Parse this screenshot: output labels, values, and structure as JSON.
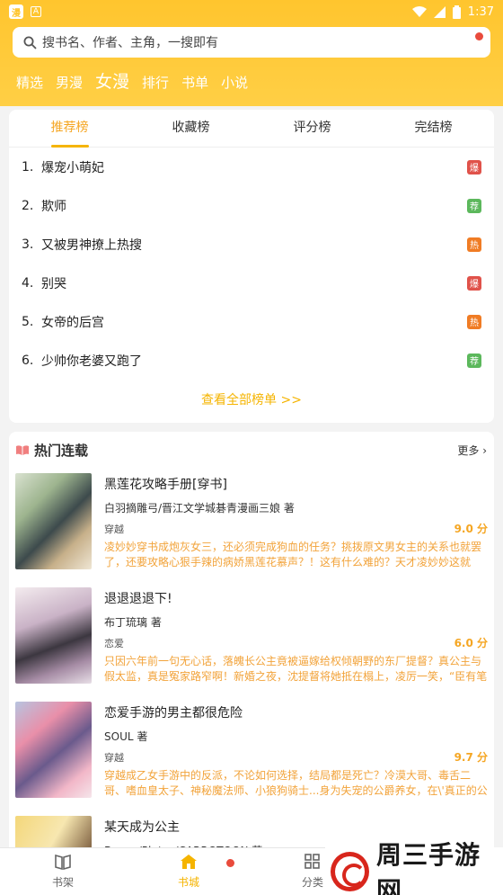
{
  "status_bar": {
    "time": "1:37",
    "app_mark": "漫",
    "a_mark": "A"
  },
  "search": {
    "placeholder": "搜书名、作者、主角，一搜即有"
  },
  "channel_tabs": [
    "精选",
    "男漫",
    "女漫",
    "排行",
    "书单",
    "小说"
  ],
  "channel_active": "女漫",
  "rank_tabs": [
    "推荐榜",
    "收藏榜",
    "评分榜",
    "完结榜"
  ],
  "rank_list": [
    {
      "num": "1.",
      "title": "爆宠小萌妃",
      "badge": "爆",
      "badge_color": "#e0524a"
    },
    {
      "num": "2.",
      "title": "欺师",
      "badge": "荐",
      "badge_color": "#5cb85c"
    },
    {
      "num": "3.",
      "title": "又被男神撩上热搜",
      "badge": "热",
      "badge_color": "#f07c24"
    },
    {
      "num": "4.",
      "title": "别哭",
      "badge": "爆",
      "badge_color": "#e0524a"
    },
    {
      "num": "5.",
      "title": "女帝的后宫",
      "badge": "热",
      "badge_color": "#f07c24"
    },
    {
      "num": "6.",
      "title": "少帅你老婆又跑了",
      "badge": "荐",
      "badge_color": "#5cb85c"
    }
  ],
  "view_all": "查看全部榜单 >>",
  "hot": {
    "title": "热门连载",
    "more": "更多",
    "books": [
      {
        "title": "黑莲花攻略手册[穿书]",
        "author": "白羽摘雕弓/晋江文学城碁青漫画三娘 著",
        "genre": "穿越",
        "score": "9.0 分",
        "desc": "凌妙妙穿书成炮灰女三，还必须完成狗血的任务？挑拨原文男女主的关系也就罢了，还要攻略心狠手辣的病娇黑莲花慕声？！这有什么难的？天才凌妙妙这就将..."
      },
      {
        "title": "退退退退下!",
        "author": "布丁琉璃 著",
        "genre": "恋爱",
        "score": "6.0 分",
        "desc": "只因六年前一句无心话，落魄长公主竟被逼嫁给权倾朝野的东厂提督？真公主与假太监，真是冤家路窄啊！新婚之夜，沈提督将她抵在榻上，凌厉一笑，“臣有笔账..."
      },
      {
        "title": "恋爱手游的男主都很危险",
        "author": "SOUL 著",
        "genre": "穿越",
        "score": "9.7 分",
        "desc": "穿越成乙女手游中的反派，不论如何选择，结局都是死亡？冷漠大哥、毒舌二哥、嗜血皇太子、神秘魔法师、小狼狗骑士...身为失宠的公爵养女，在\\'真正的公爵千..."
      },
      {
        "title": "某天成为公主",
        "author": "Beeee/Plutus/CARROTOON 著",
        "genre": "",
        "score": "",
        "desc": ""
      }
    ]
  },
  "bottom_nav": [
    "书架",
    "书城",
    "分类"
  ],
  "watermark": "周三手游网",
  "colors": {
    "brand": "#ffc52e",
    "accent": "#f5b400"
  }
}
